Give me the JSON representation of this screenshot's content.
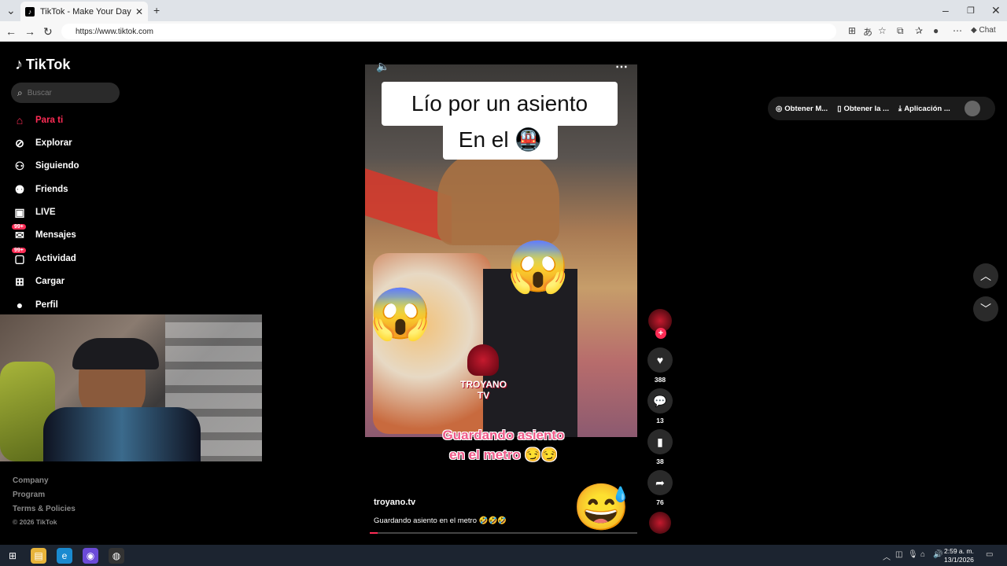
{
  "browser": {
    "tab_title": "TikTok - Make Your Day",
    "url": "https://www.tiktok.com",
    "chat_label": "Chat"
  },
  "sidebar": {
    "logo": "TikTok",
    "search_placeholder": "Buscar",
    "items": [
      {
        "label": "Para ti",
        "icon": "home-icon"
      },
      {
        "label": "Explorar",
        "icon": "compass-icon"
      },
      {
        "label": "Siguiendo",
        "icon": "user-follow-icon"
      },
      {
        "label": "Friends",
        "icon": "friends-icon"
      },
      {
        "label": "LIVE",
        "icon": "live-tv-icon"
      },
      {
        "label": "Mensajes",
        "icon": "message-icon",
        "badge": "99+"
      },
      {
        "label": "Actividad",
        "icon": "activity-icon",
        "badge": "99+"
      },
      {
        "label": "Cargar",
        "icon": "upload-icon"
      },
      {
        "label": "Perfil",
        "icon": "avatar"
      }
    ],
    "footer": [
      "Company",
      "Program",
      "Terms & Policies",
      "© 2026 TikTok"
    ]
  },
  "topright": {
    "btn1": "Obtener M...",
    "btn2": "Obtener la ...",
    "btn3": "Aplicación ..."
  },
  "video": {
    "overlay_title_line1": "Lío por un asiento",
    "overlay_title_line2": "En el 🚇",
    "overlay_caption_line1": "Guardando asiento",
    "overlay_caption_line2": "en el metro 😏😏",
    "watermark_line1": "TROYANO",
    "watermark_line2": "TV",
    "author": "troyano.tv",
    "description": "Guardando asiento en el metro 🤣🤣🤣",
    "progress": 0.03
  },
  "actions": {
    "likes": "388",
    "comments": "13",
    "saves": "38",
    "shares": "76"
  },
  "taskbar": {
    "time": "2:59 a. m.",
    "date": "13/1/2026"
  }
}
